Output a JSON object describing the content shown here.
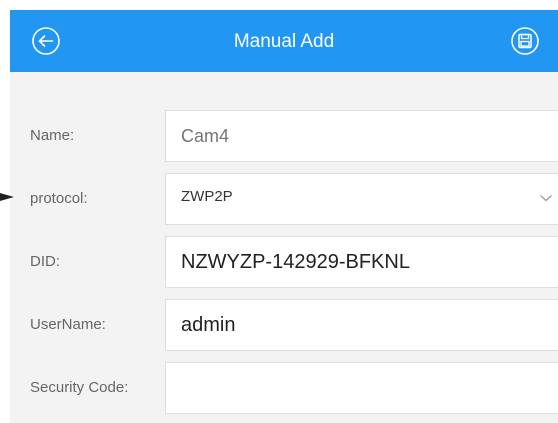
{
  "header": {
    "title": "Manual Add",
    "background": "#2196f3",
    "back_icon": "back-circle-arrow-icon",
    "save_icon": "save-floppy-icon"
  },
  "form": {
    "name": {
      "label": "Name:",
      "placeholder": "Cam4",
      "value": ""
    },
    "protocol": {
      "label": "protocol:",
      "selected": "ZWP2P"
    },
    "did": {
      "label": "DID:",
      "value": "NZWYZP-142929-BFKNL"
    },
    "username": {
      "label": "UserName:",
      "value": "admin"
    },
    "security_code": {
      "label": "Security Code:",
      "value": ""
    }
  }
}
